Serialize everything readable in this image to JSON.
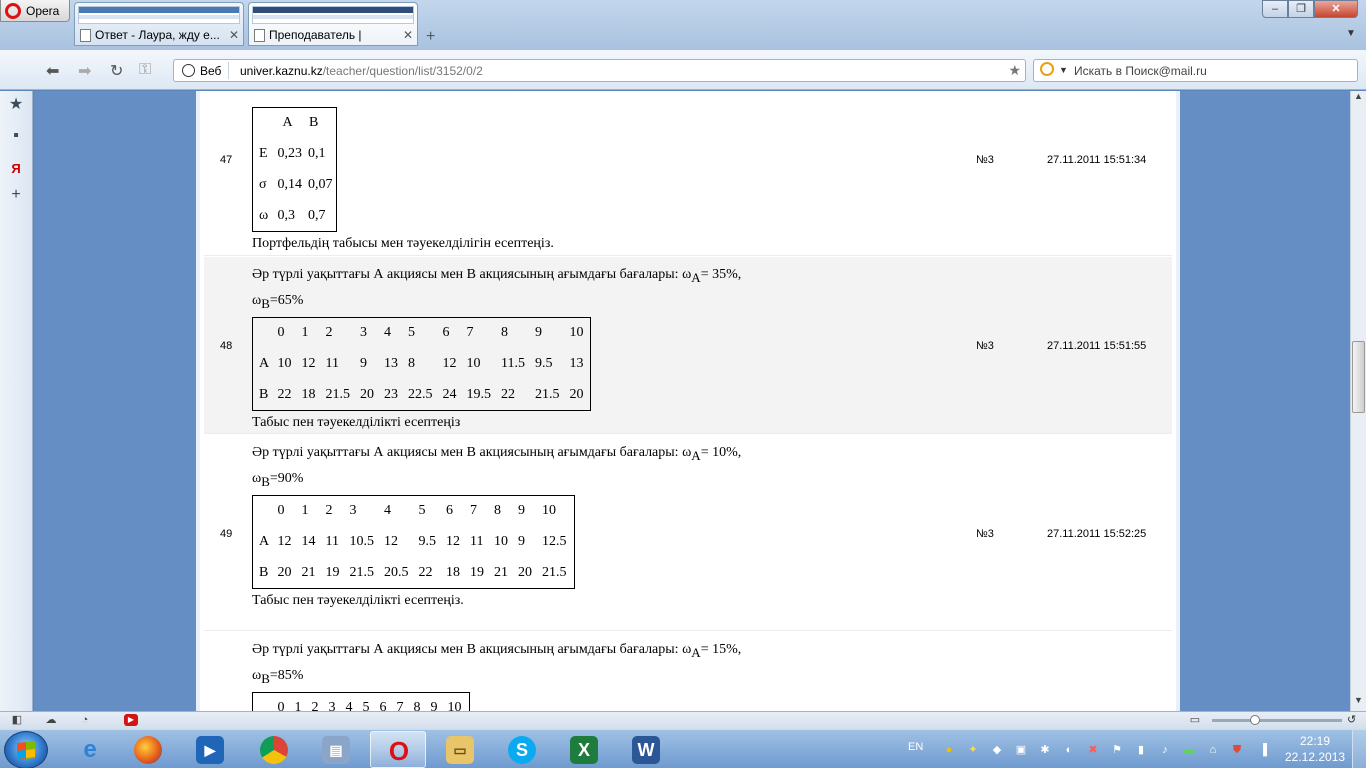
{
  "browser": {
    "menu_label": "Opera",
    "tabs": [
      {
        "label": "Ответ - Лаура, жду е..."
      },
      {
        "label": "Преподаватель |"
      }
    ],
    "new_tab": "+",
    "address_prefix": "Веб",
    "url_host": "univer.kaznu.kz",
    "url_path": "/teacher/question/list/3152/0/2",
    "search_placeholder": "Искать в Поиск@mail.ru"
  },
  "rows": [
    {
      "num": "47",
      "variant": "№3",
      "date": "27.11.2011 15:51:34",
      "lines": [],
      "table": [
        [
          "",
          "A",
          "B"
        ],
        [
          "E",
          "0,23",
          "0,1"
        ],
        [
          "σ",
          "0,14",
          "0,07"
        ],
        [
          "ω",
          "0,3",
          "0,7"
        ]
      ],
      "after": "Портфельдің табысы мен тәуекелділігін есептеңіз."
    },
    {
      "num": "48",
      "variant": "№3",
      "date": "27.11.2011 15:51:55",
      "line1_pre": "Әр түрлі уақыттағы А акциясы мен В акциясының  ағымдағы бағалары: ω",
      "line1_sub": "A",
      "line1_post": "= 35%,",
      "line2_pre": "ω",
      "line2_sub": "B",
      "line2_post": "=65%",
      "table": [
        [
          "",
          "0",
          "1",
          "2",
          "3",
          "4",
          "5",
          "6",
          "7",
          "8",
          "9",
          "10"
        ],
        [
          "A",
          "10",
          "12",
          "11",
          "9",
          "13",
          "8",
          "12",
          "10",
          "11.5",
          "9.5",
          "13"
        ],
        [
          "B",
          "22",
          "18",
          "21.5",
          "20",
          "23",
          "22.5",
          "24",
          "19.5",
          "22",
          "21.5",
          "20"
        ]
      ],
      "after": "Табыс пен тәуекелділікті есептеңіз"
    },
    {
      "num": "49",
      "variant": "№3",
      "date": "27.11.2011 15:52:25",
      "line1_pre": "Әр түрлі уақыттағы А акциясы мен В акциясының  ағымдағы бағалары: ω",
      "line1_sub": "A",
      "line1_post": "= 10%,",
      "line2_pre": "ω",
      "line2_sub": "B",
      "line2_post": "=90%",
      "table": [
        [
          "",
          "0",
          "1",
          "2",
          "3",
          "4",
          "5",
          "6",
          "7",
          "8",
          "9",
          "10"
        ],
        [
          "A",
          "12",
          "14",
          "11",
          "10.5",
          "12",
          "9.5",
          "12",
          "11",
          "10",
          "9",
          "12.5"
        ],
        [
          "B",
          "20",
          "21",
          "19",
          "21.5",
          "20.5",
          "22",
          "18",
          "19",
          "21",
          "20",
          "21.5"
        ]
      ],
      "after": "Табыс пен тәуекелділікті есептеңіз."
    },
    {
      "num": "",
      "variant": "",
      "date": "",
      "line1_pre": "Әр түрлі уақыттағы А акциясы мен В акциясының  ағымдағы бағалары: ω",
      "line1_sub": "A",
      "line1_post": "= 15%,",
      "line2_pre": "ω",
      "line2_sub": "B",
      "line2_post": "=85%",
      "table": [
        [
          "",
          "0",
          "1",
          "2",
          "3",
          "4",
          "5",
          "6",
          "7",
          "8",
          "9",
          "10"
        ]
      ],
      "after": ""
    }
  ],
  "taskbar": {
    "lang": "EN",
    "time": "22:19",
    "date": "22.12.2013",
    "apps": [
      "ie-icon",
      "firefox-icon",
      "media-player-icon",
      "chrome-icon",
      "network-icon",
      "opera-icon",
      "explorer-icon",
      "skype-icon",
      "excel-icon",
      "word-icon"
    ]
  },
  "colors": {
    "page_bg": "#658fc4",
    "row_alt": "#f3f3f3",
    "taskbar": "#6f9bd0"
  }
}
